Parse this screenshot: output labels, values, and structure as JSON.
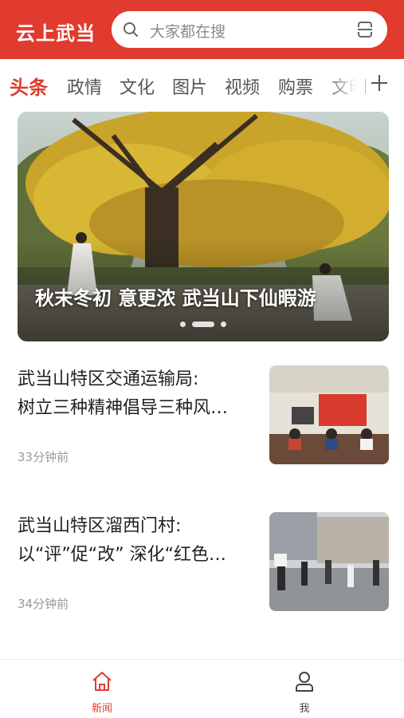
{
  "app": {
    "title": "云上武当"
  },
  "search": {
    "placeholder": "大家都在搜"
  },
  "tabs": [
    {
      "label": "头条",
      "active": true
    },
    {
      "label": "政情"
    },
    {
      "label": "文化"
    },
    {
      "label": "图片"
    },
    {
      "label": "视频"
    },
    {
      "label": "购票"
    },
    {
      "label": "文明"
    }
  ],
  "banner": {
    "caption": "秋末冬初 意更浓 武当山下仙暇游",
    "slide_count": 3,
    "active_slide": 2
  },
  "news": [
    {
      "title_line1": "武当山特区交通运输局:",
      "title_line2": "树立三种精神倡导三种风…",
      "time": "33分钟前"
    },
    {
      "title_line1": "武当山特区溜西门村:",
      "title_line2": "以“评”促“改” 深化“红色…",
      "time": "34分钟前"
    }
  ],
  "bottom_nav": [
    {
      "label": "新闻",
      "icon": "home-icon",
      "active": true
    },
    {
      "label": "我",
      "icon": "user-icon",
      "active": false
    }
  ],
  "colors": {
    "brand": "#e03b2e",
    "tab_inactive": "#555555",
    "time_text": "#999999"
  }
}
